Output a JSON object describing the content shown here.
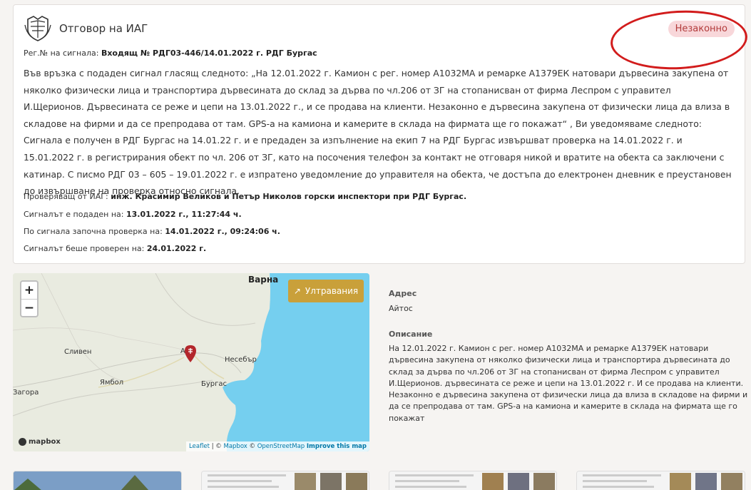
{
  "signal": {
    "title": "Отговор на ИАГ",
    "status": "Незаконно",
    "status_color": "#b23a3a",
    "reg_label": "Рег.№ на сигнала:",
    "reg_value": "Входящ № РДГ03-446/14.01.2022 г. РДГ Бургас",
    "body": "Във връзка с подаден сигнал гласящ следното: „На 12.01.2022 г. Камион с рег. номер А1032МА и ремарке А1379ЕК натовари дървесина закупена от няколко физически лица и транспортира дървесината до склад за дърва по чл.206 от ЗГ на стопанисван от фирма Леспром с управител И.Щерионов. Дървесината се реже и цепи на 13.01.2022 г., и се продава на клиенти. Незаконно е дървесина закупена от физически лица да влиза в складове на фирми и да се препродава от там. GPS-а на камиона и камерите в склада на фирмата ще го покажат“ , Ви уведомяваме следното: Сигнала е получен в РДГ Бургас на 14.01.22 г. и е предаден за изпълнение на екип 7 на РДГ Бургас извършват проверка на 14.01.2022 г. и 15.01.2022 г. в регистрирания обект по чл. 206 от ЗГ, като на посочения телефон за контакт не отговаря никой и вратите на обекта са заключени с катинар. С писмо РДГ 03 – 605 – 19.01.2022 г. е изпратено уведомление до управителя на обекта, че достъпа до електронен дневник е преустановен до извършване на проверка относно сигнала.",
    "inspector_label": "Проверяващ от ИАГ:",
    "inspector_value": "инж. Красимир Великов и Петър Николов горски инспектори при РДГ Бургас.",
    "submitted_label": "Сигналът е подаден на:",
    "submitted_value": "13.01.2022 г., 11:27:44 ч.",
    "check_start_label": "По сигнала започна проверка на:",
    "check_start_value": "14.01.2022 г., 09:24:06 ч.",
    "checked_label": "Сигналът беше проверен на:",
    "checked_value": "24.01.2022 г."
  },
  "map": {
    "zoom_in": "+",
    "zoom_out": "−",
    "button_label": "Ултравания",
    "mapbox_logo": "mapbox",
    "attribution_leaflet": "Leaflet",
    "attribution_mapbox": "Mapbox",
    "attribution_osm": "OpenStreetMap",
    "attribution_improve": "Improve this map",
    "labels": {
      "varna": "Варна",
      "sliven": "Сливен",
      "nesebar": "Несебър",
      "burgas": "Бургас",
      "yambol": "Ямбол",
      "zagora": "Загора",
      "aitos": "А"
    },
    "sea_color": "#75cfef",
    "land_color": "#e9ebe0",
    "marker_color": "#b3262b"
  },
  "details": {
    "address_label": "Адрес",
    "address_value": "Айтос",
    "description_label": "Описание",
    "description_value": "На 12.01.2022 г. Камион с рег. номер А1032МА и ремарке А1379ЕК натовари дървесина закупена от няколко физически лица и транспортира дървесината до склад за дърва по чл.206 от ЗГ на стопанисван от фирма Леспром с управител И.Щерионов. дървесината се реже и цепи на 13.01.2022 г. И се продава на клиенти. Незаконно е дървесина закупена от физически лица да влиза в складове на фирми и да се препродава от там. GPS-а на камиона и камерите в склада на фирмата ще го покажат"
  },
  "accent_color": "#c9a03a"
}
